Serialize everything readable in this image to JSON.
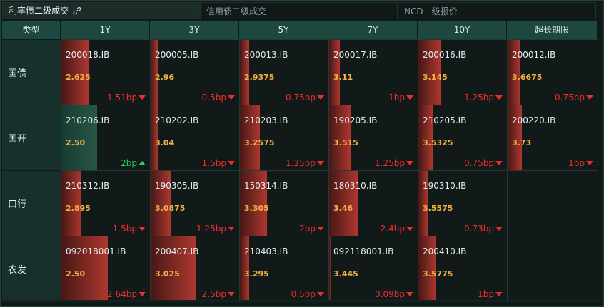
{
  "tabs": [
    {
      "label": "利率债二级成交",
      "active": true
    },
    {
      "label": "信用债二级成交",
      "active": false
    },
    {
      "label": "NCD一级报价",
      "active": false
    }
  ],
  "columns": [
    "类型",
    "1Y",
    "3Y",
    "5Y",
    "7Y",
    "10Y",
    "超长期限"
  ],
  "rows": [
    {
      "label": "国债",
      "cells": [
        {
          "code": "200018.IB",
          "yield": "2.625",
          "change": "1.51bp",
          "dir": "down",
          "level": 0.3
        },
        {
          "code": "200005.IB",
          "yield": "2.96",
          "change": "0.5bp",
          "dir": "down",
          "level": 0.08
        },
        {
          "code": "200013.IB",
          "yield": "2.9375",
          "change": "0.75bp",
          "dir": "down",
          "level": 0.1
        },
        {
          "code": "200017.IB",
          "yield": "3.11",
          "change": "1bp",
          "dir": "down",
          "level": 0.12
        },
        {
          "code": "200016.IB",
          "yield": "3.145",
          "change": "1.25bp",
          "dir": "down",
          "level": 0.25
        },
        {
          "code": "200012.IB",
          "yield": "3.6675",
          "change": "0.75bp",
          "dir": "down",
          "level": 0.14
        }
      ]
    },
    {
      "label": "国开",
      "cells": [
        {
          "code": "210206.IB",
          "yield": "2.50",
          "change": "2bp",
          "dir": "up",
          "level": 0.4
        },
        {
          "code": "210202.IB",
          "yield": "3.04",
          "change": "1.5bp",
          "dir": "down",
          "level": 0.08
        },
        {
          "code": "210203.IB",
          "yield": "3.2575",
          "change": "1.25bp",
          "dir": "down",
          "level": 0.22
        },
        {
          "code": "190205.IB",
          "yield": "3.515",
          "change": "1.25bp",
          "dir": "down",
          "level": 0.24
        },
        {
          "code": "210205.IB",
          "yield": "3.5325",
          "change": "0.75bp",
          "dir": "down",
          "level": 0.16
        },
        {
          "code": "200220.IB",
          "yield": "3.73",
          "change": "1bp",
          "dir": "down",
          "level": 0.16
        }
      ]
    },
    {
      "label": "口行",
      "cells": [
        {
          "code": "210312.IB",
          "yield": "2.895",
          "change": "1.5bp",
          "dir": "down",
          "level": 0.22
        },
        {
          "code": "190305.IB",
          "yield": "3.0875",
          "change": "1.25bp",
          "dir": "down",
          "level": 0.22
        },
        {
          "code": "150314.IB",
          "yield": "3.305",
          "change": "2bp",
          "dir": "down",
          "level": 0.3
        },
        {
          "code": "180310.IB",
          "yield": "3.46",
          "change": "2.4bp",
          "dir": "down",
          "level": 0.32
        },
        {
          "code": "190310.IB",
          "yield": "3.5575",
          "change": "0.73bp",
          "dir": "down",
          "level": 0.1
        },
        null
      ]
    },
    {
      "label": "农发",
      "cells": [
        {
          "code": "092018001.IB",
          "yield": "2.50",
          "change": "2.64bp",
          "dir": "down",
          "level": 0.52
        },
        {
          "code": "200407.IB",
          "yield": "3.025",
          "change": "2.5bp",
          "dir": "down",
          "level": 0.5
        },
        {
          "code": "210403.IB",
          "yield": "3.295",
          "change": "0.5bp",
          "dir": "down",
          "level": 0.1
        },
        {
          "code": "092118001.IB",
          "yield": "3.445",
          "change": "0.09bp",
          "dir": "down",
          "level": 0.02
        },
        {
          "code": "200410.IB",
          "yield": "3.5775",
          "change": "1bp",
          "dir": "down",
          "level": 0.2
        },
        null
      ]
    }
  ]
}
